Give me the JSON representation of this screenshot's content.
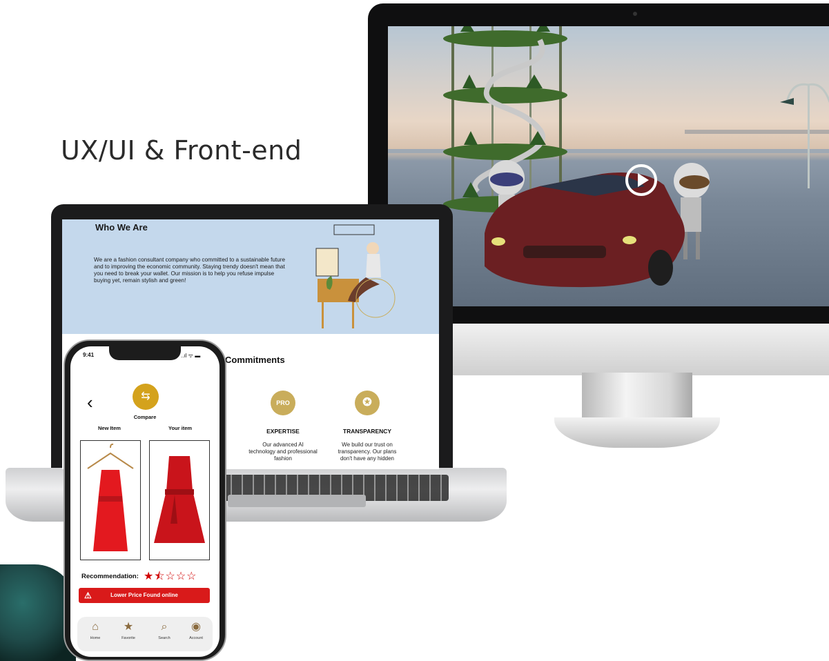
{
  "page": {
    "heading": "UX/UI & Front-end"
  },
  "desktop": {
    "video": {
      "play_icon": "play-icon"
    }
  },
  "laptop": {
    "who_we_are": {
      "title": "Who We Are",
      "text": "We are a fashion consultant company who committed to a sustainable future and to improving the economic community. Staying trendy doesn't mean that you need to break your wallet. Our mission is to help you refuse impulse buying yet, remain stylish and green!"
    },
    "commitments_title": "Commitments",
    "features": [
      {
        "badge": "PRO",
        "title": "EXPERTISE",
        "description": "Our advanced AI technology and professional fashion"
      },
      {
        "badge": "✪",
        "title": "TRANSPARENCY",
        "description": "We build our trust on transparency. Our plans don't have any hidden"
      }
    ]
  },
  "phone": {
    "time": "9:41",
    "status_icons": "..ıl ᯤ ▬",
    "back_icon": "‹",
    "compare_label": "Compare",
    "col_new": "New Item",
    "col_yours": "Your item",
    "recommendation_label": "Recommendation:",
    "rating": 1.5,
    "rating_max": 5,
    "stars_text": "★⯪☆☆☆",
    "alert_icon": "⚠",
    "alert_text": "Lower Price Found online",
    "tabs": [
      {
        "icon": "⌂",
        "label": "Home"
      },
      {
        "icon": "★",
        "label": "Favorite"
      },
      {
        "icon": "⌕",
        "label": "Search"
      },
      {
        "icon": "◉",
        "label": "Account"
      }
    ]
  },
  "colors": {
    "accent_gold": "#c9ad5b",
    "alert_red": "#d91a1a",
    "hero_blue": "#c4d8ec"
  }
}
